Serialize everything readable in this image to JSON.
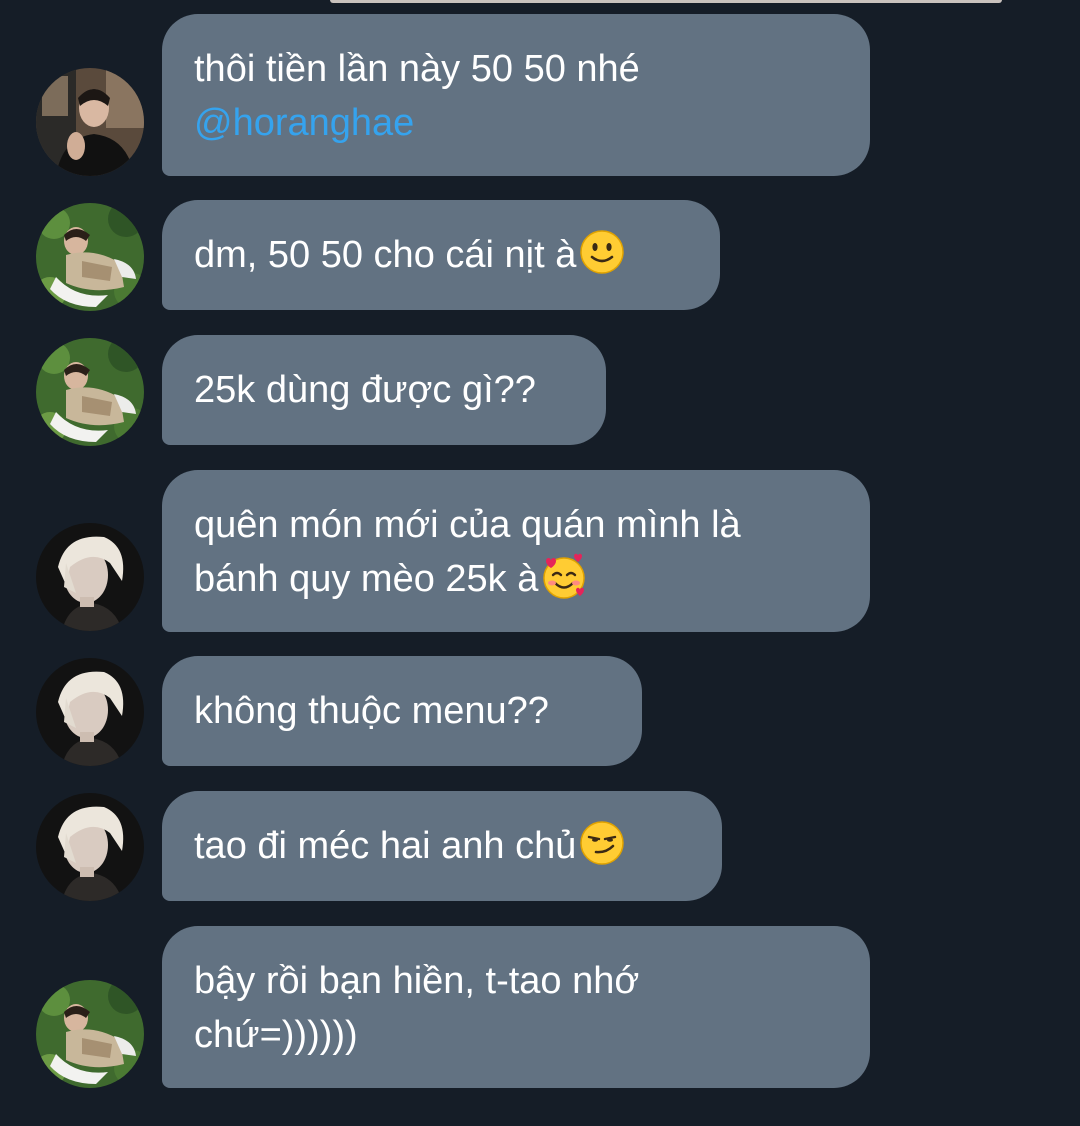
{
  "messages": [
    {
      "avatar": "avatar-dark-shirt",
      "lines": [
        "thôi tiền lần này 50 50 nhé"
      ],
      "mention": "@horanghae"
    },
    {
      "avatar": "avatar-garden",
      "lines": [
        "dm, 50 50 cho cái nịt à"
      ],
      "emoji": "slightly-smiling-face-icon"
    },
    {
      "avatar": "avatar-garden",
      "lines": [
        "25k dùng được gì??"
      ]
    },
    {
      "avatar": "avatar-blond",
      "lines": [
        "quên món mới của quán mình là",
        "bánh quy mèo 25k à"
      ],
      "emoji": "smiling-face-with-hearts-icon"
    },
    {
      "avatar": "avatar-blond",
      "lines": [
        "không thuộc menu??"
      ]
    },
    {
      "avatar": "avatar-blond",
      "lines": [
        "tao đi méc hai anh chủ"
      ],
      "emoji": "smirking-face-icon"
    },
    {
      "avatar": "avatar-garden",
      "lines": [
        "bậy rồi bạn hiền, t-tao nhớ",
        "chứ=))))))"
      ]
    }
  ],
  "colors": {
    "background": "#151d27",
    "bubble": "#627282",
    "text": "#ffffff",
    "mention": "#35a3ee"
  }
}
